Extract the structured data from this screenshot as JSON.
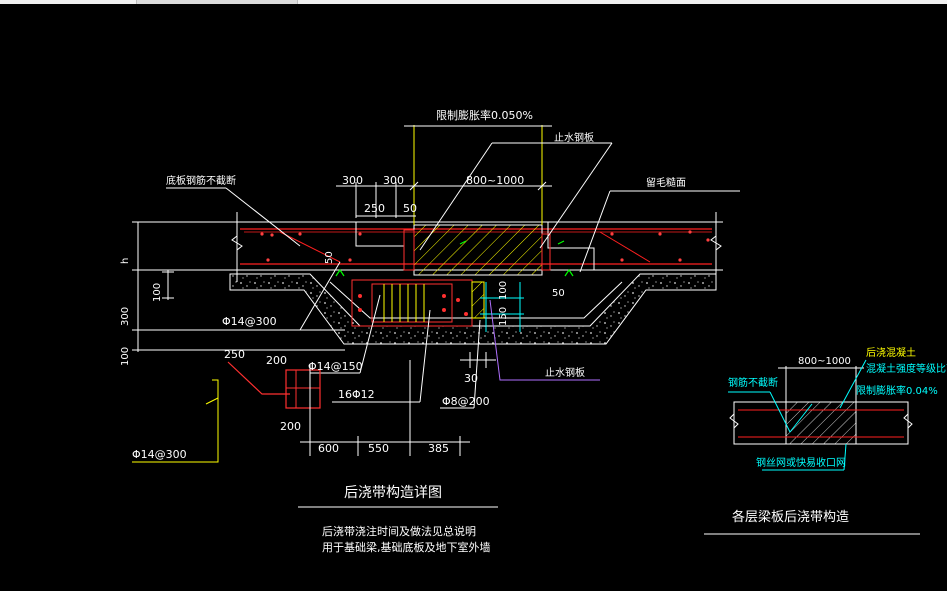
{
  "main_detail": {
    "title": "后浇带构造详图",
    "note_line1": "后浇带浇注时间及做法见总说明",
    "note_line2": "用于基础梁,基础底板及地下室外墙",
    "labels": {
      "rebar_ratio": "限制膨胀率0.050%",
      "waterstop_plate": "止水钢板",
      "bottom_rebar": "底板钢筋不截断",
      "rough_surface": "留毛糙面",
      "waterstop_plate_2": "止水钢板"
    },
    "dims": {
      "d300a": "300",
      "d300b": "300",
      "d250": "250",
      "d50a": "50",
      "d800_1000": "800~1000",
      "h": "h",
      "d50b": "50",
      "d100a": "100",
      "d300c": "300",
      "d100b": "100",
      "d100c": "100",
      "d150": "150",
      "d50c": "50",
      "d30": "30",
      "d250b": "250",
      "d200a": "200",
      "d200b": "200",
      "d600": "600",
      "d550": "550",
      "d385": "385"
    },
    "rebar": {
      "phi14_300": "Φ14@300",
      "phi14_150": "Φ14@150",
      "bars16": "16Φ12",
      "phi8_200": "Φ8@200",
      "phi14_300b": "Φ14@300"
    }
  },
  "side_detail": {
    "title": "各层梁板后浇带构造",
    "dim": "800~1000",
    "label_pour": "后浇混凝土",
    "label_concrete": "混凝土强度等级比两侧",
    "label_ratio": "限制膨胀率0.04%",
    "label_rebar": "钢筋不截断",
    "label_bottom": "钢丝网或快易收口网"
  }
}
